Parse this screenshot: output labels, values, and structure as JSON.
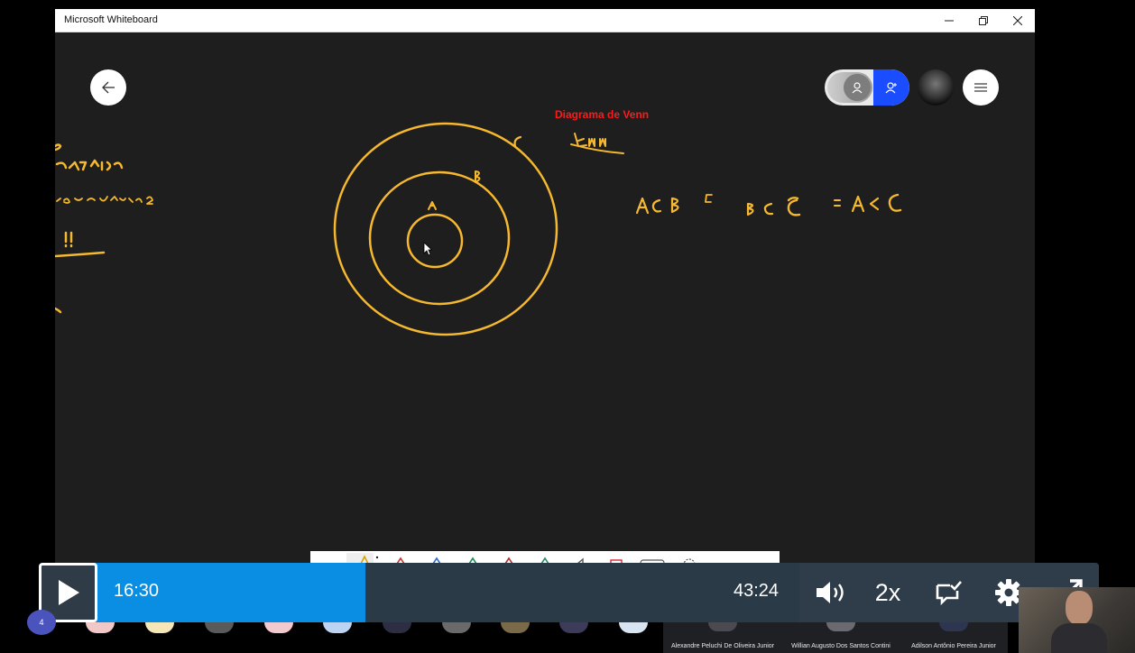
{
  "window": {
    "title": "Microsoft Whiteboard",
    "minimize_icon": "minimize-icon",
    "restore_icon": "restore-icon",
    "close_icon": "close-icon"
  },
  "whiteboard": {
    "heading": "Diagrama de Venn",
    "back_icon": "arrow-left-icon",
    "menu_icon": "hamburger-menu-icon",
    "colors": {
      "ink": "#f5b82e",
      "heading": "#ff1a1a",
      "canvas": "#1e1e1e",
      "toggle_active": "#1a4dff"
    }
  },
  "player": {
    "current_time": "16:30",
    "total_time": "43:24",
    "speed": "2x",
    "progress_percent": 30.8,
    "colors": {
      "played": "#0a8ee3",
      "bar": "#2b3a47"
    }
  },
  "participants": {
    "count_badge": "4",
    "tiles": [
      {
        "name": "Alexandre Peluchi De Oliveira Junior"
      },
      {
        "name": "Willian Augusto Dos Santos Contini"
      },
      {
        "name": "Adilson Antônio Pereira Junior"
      }
    ]
  }
}
